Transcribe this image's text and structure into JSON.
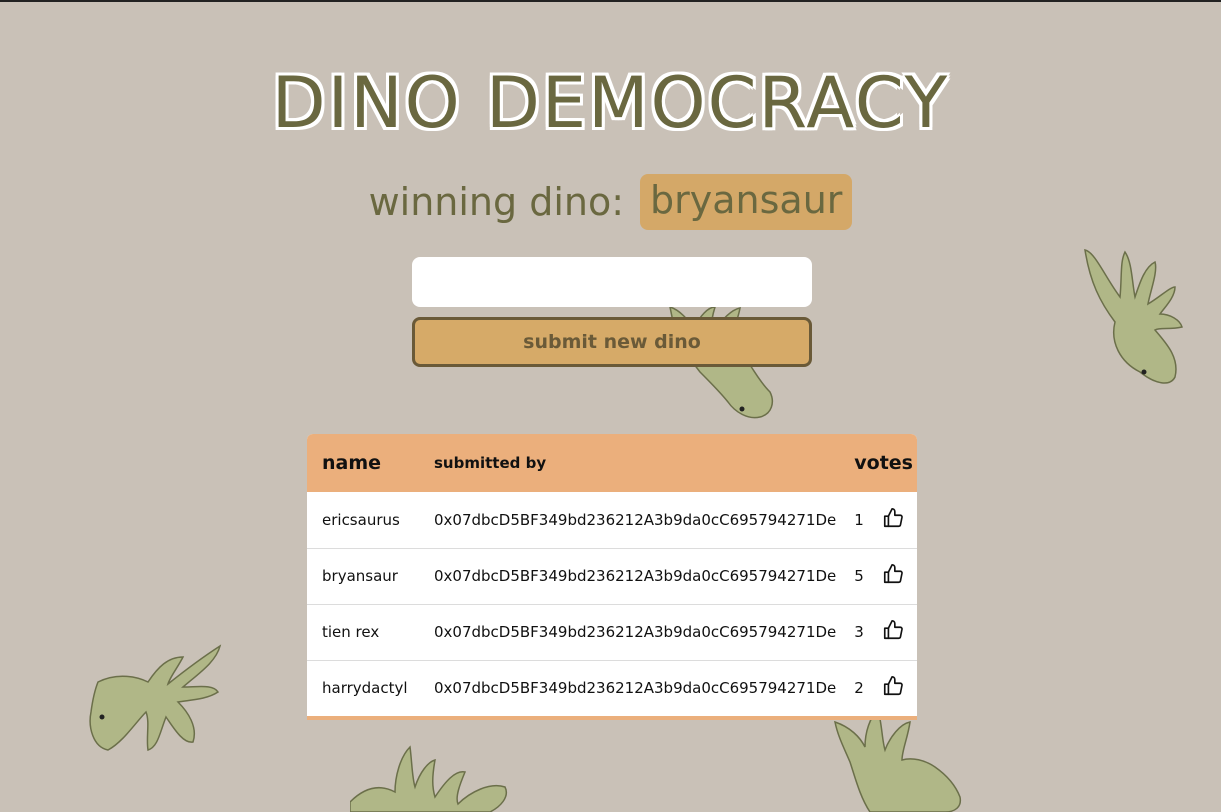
{
  "header": {
    "title": "DINO DEMOCRACY",
    "winning_label": "winning dino:",
    "winning_name": "bryansaur"
  },
  "form": {
    "input_value": "",
    "input_placeholder": "",
    "submit_label": "submit new dino"
  },
  "table": {
    "headers": {
      "name": "name",
      "submitted_by": "submitted by",
      "votes": "votes"
    },
    "rows": [
      {
        "name": "ericsaurus",
        "submitted_by": "0x07dbcD5BF349bd236212A3b9da0cC695794271De",
        "votes": "1",
        "icon": "thumbs-up-icon"
      },
      {
        "name": "bryansaur",
        "submitted_by": "0x07dbcD5BF349bd236212A3b9da0cC695794271De",
        "votes": "5",
        "icon": "thumbs-up-icon"
      },
      {
        "name": "tien rex",
        "submitted_by": "0x07dbcD5BF349bd236212A3b9da0cC695794271De",
        "votes": "3",
        "icon": "thumbs-up-icon"
      },
      {
        "name": "harrydactyl",
        "submitted_by": "0x07dbcD5BF349bd236212A3b9da0cC695794271De",
        "votes": "2",
        "icon": "thumbs-up-icon"
      }
    ]
  },
  "colors": {
    "background": "#c9c1b7",
    "title": "#6a6840",
    "accent": "#d6aa68",
    "table_header": "#ebaf7c",
    "dino": "#b0b787"
  }
}
